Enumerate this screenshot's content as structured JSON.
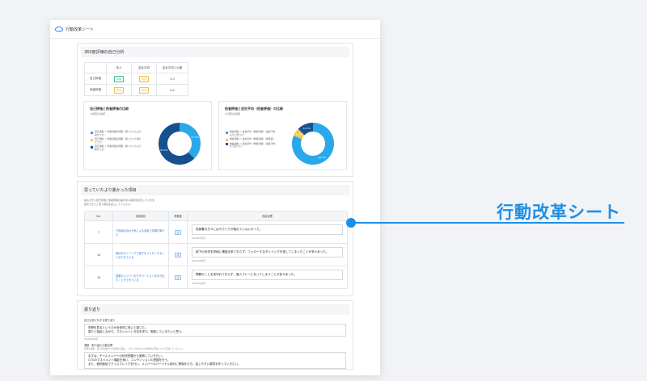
{
  "app": {
    "title": "行動改革シート"
  },
  "self_analysis": {
    "title": "360度評価の自己分析",
    "headers": [
      "",
      "本人",
      "会社平均",
      "会社平均との差"
    ],
    "rows": [
      {
        "label": "自己評価",
        "self": "3.6",
        "avg": "3.3",
        "diff": "0.3"
      },
      {
        "label": "他者評価",
        "self": "3.7",
        "avg": "3.3",
        "diff": "0.4"
      }
    ]
  },
  "chart_data": [
    {
      "type": "pie",
      "title": "自己評価と他者評価の比較",
      "subtitle": "16項目の指標",
      "legend": [
        "自己評価 ＝ 他者評価の項目（思っていたより良かった）",
        "自己評価 ＞ 他者評価の項目（思っていた通りだった）",
        "自己評価 ＜ 他者評価の項目（思っていたより悪かった）"
      ],
      "values": [
        37.5,
        0,
        62.5
      ],
      "colors": [
        "#29a8ea",
        "#f2c94c",
        "#17508e"
      ]
    },
    {
      "type": "pie",
      "title": "他者評価と会社平均（他者評価）の比較",
      "subtitle": "16項目の指標",
      "legend": [
        "他者評価 ＞ 会社平均（他者評価）（会社平均より上回った）",
        "他者評価 ＝ 会社平均（他者評価）（標準値）",
        "他者評価 ＜ 会社平均（他者評価）（会社平均を下回った）"
      ],
      "values": [
        81.3,
        6.2,
        12.5
      ],
      "colors": [
        "#29a8ea",
        "#f2c94c",
        "#17508e"
      ]
    }
  ],
  "feedback": {
    "title": "思っていたより悪かった項目",
    "desc": [
      "最も大きい自己評価と他者評価の差がある項目を表示しています。",
      "改善できたと思う項目を記入してください。"
    ],
    "headers": [
      "No.",
      "評価項目",
      "重要度",
      "改善目標"
    ],
    "rows": [
      {
        "no": "7",
        "item": "下部組み合わせ系による会議で成果を挙げた",
        "importance": "高",
        "note": "他部署の方々とはやりとりが取れていないかった。",
        "count": "25/1000文字"
      },
      {
        "no": "16",
        "item": "適切なタイミングで部下をフォローすることができている",
        "importance": "高",
        "note": "部下の状況を詳細に確認出来ておらず、フォローするタイミングを逃してしまったことが多々あった。",
        "count": "46/1000文字"
      },
      {
        "no": "18",
        "item": "部署のメンバーのモチベーションを引き出すことができている",
        "importance": "高",
        "note": "問題のことを見切れておらず、個人プレーになってしまうことが多々あった。",
        "count": "35/1000文字"
      }
    ]
  },
  "review": {
    "title": "振り返り",
    "label": "自己分析に対する振り返り",
    "text": [
      "同僚を見るという力が全体的に低いと感じた。",
      "周りと相談しながら、マネジメント方法を学び、実践していきたいと思う。"
    ],
    "count": "35/1000文字",
    "sub_title": "課題・取り組む行動目標",
    "sub_note": "行動の課題、自分が意識すべき目標を記載し、その上であなたの具体的な行動について記述してください。",
    "text2": [
      "まずは、チームメンバーの状況把握から実践していきたい。",
      "CTOのマネジメント機能を使い、コンディションの把握を行う。",
      "また、個別面談でアイスブレイクを行い、メンバーのパーソナル部分に興味をもち、話しやすい環境を作っていきたい。"
    ]
  },
  "callout": {
    "text": "行動改革シート"
  }
}
